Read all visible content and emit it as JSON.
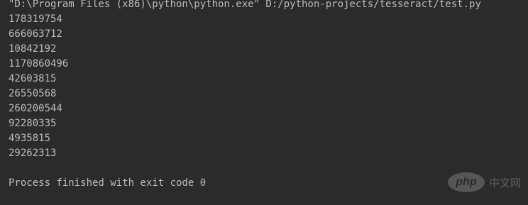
{
  "console": {
    "command": "\"D:\\Program Files (x86)\\python\\python.exe\" D:/python-projects/tesseract/test.py",
    "outputs": [
      "178319754",
      "666063712",
      "10842192",
      "1170860496",
      "42603815",
      "26550568",
      "260200544",
      "92280335",
      "4935815",
      "29262313"
    ],
    "exit_message": "Process finished with exit code 0"
  },
  "watermark": {
    "logo_text": "php",
    "site_text": "中文网"
  },
  "colors": {
    "background": "#2b2b2b",
    "text": "#bbbbbb"
  }
}
